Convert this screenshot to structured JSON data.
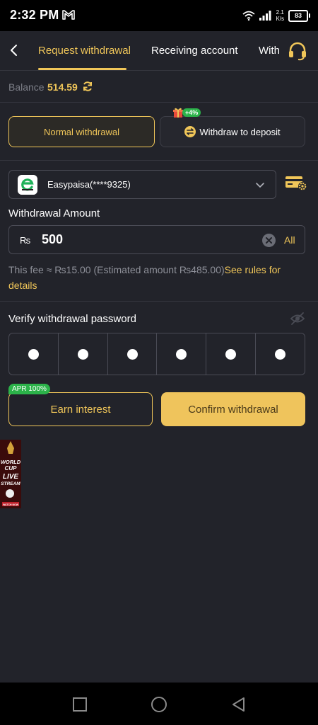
{
  "status_bar": {
    "time": "2:32 PM",
    "net_speed_value": "2.1",
    "net_speed_unit": "K/s",
    "battery": "83"
  },
  "header": {
    "tabs": [
      {
        "label": "Request withdrawal",
        "active": true
      },
      {
        "label": "Receiving account",
        "active": false
      },
      {
        "label": "Withdrawal record",
        "active": false
      }
    ]
  },
  "balance": {
    "label": "Balance",
    "value": "514.59"
  },
  "modes": {
    "normal_label": "Normal withdrawal",
    "deposit_label": "Withdraw to deposit",
    "deposit_bonus": "+4%"
  },
  "account": {
    "name": "Easypaisa(****9325)"
  },
  "amount": {
    "label": "Withdrawal Amount",
    "currency": "₨",
    "value": "500",
    "all_label": "All"
  },
  "fee": {
    "text": "This fee ≈ ₨15.00 (Estimated amount ₨485.00)",
    "link": "See rules for details"
  },
  "password": {
    "label": "Verify withdrawal password",
    "digits": 6
  },
  "actions": {
    "earn_label": "Earn interest",
    "apr_badge": "APR 100%",
    "confirm_label": "Confirm withdrawal"
  },
  "promo": {
    "text_lines": [
      "WORLD",
      "CUP",
      "LIVE",
      "STREAM",
      "WATCH NOW"
    ]
  },
  "colors": {
    "accent": "#f0c659",
    "background": "#22232a",
    "badge_green": "#2cb34a"
  }
}
